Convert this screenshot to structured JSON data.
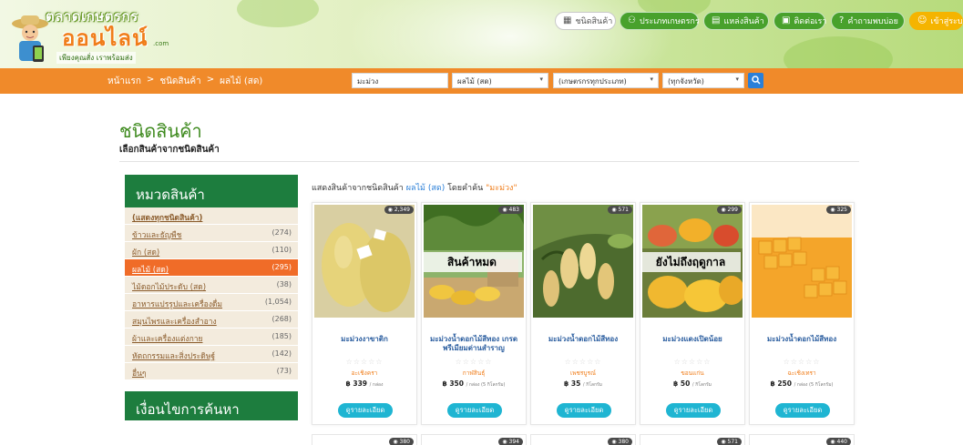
{
  "header": {
    "logo": {
      "top_text": "ตลาดเกษตรกร",
      "main_text": "ออนไลน์",
      "domain_text": ".com",
      "tagline": "เพียงคุณสั่ง เราพร้อมส่ง"
    },
    "nav": [
      {
        "label": "ชนิดสินค้า",
        "icon": "cart-icon"
      },
      {
        "label": "ประเภทเกษตรกร",
        "icon": "people-icon"
      },
      {
        "label": "แหล่งสินค้า",
        "icon": "map-icon"
      },
      {
        "label": "ติดต่อเรา",
        "icon": "contact-icon"
      },
      {
        "label": "คำถามพบบ่อย",
        "icon": "question-icon"
      },
      {
        "label": "เข้าสู่ระบบ",
        "icon": "user-icon"
      }
    ]
  },
  "breadcrumb": {
    "home": "หน้าแรก",
    "level1": "ชนิดสินค้า",
    "level2": "ผลไม้ (สด)",
    "separator": ">"
  },
  "search": {
    "keyword": "มะม่วง",
    "category": "ผลไม้ (สด)",
    "farmer_type": "(เกษตรกรทุกประเภท)",
    "province": "(ทุกจังหวัด)",
    "button_icon": "search-icon"
  },
  "page": {
    "title": "ชนิดสินค้า",
    "subtitle": "เลือกสินค้าจากชนิดสินค้า"
  },
  "sidebar": {
    "heading": "หมวดสินค้า",
    "items": [
      {
        "label": "(แสดงทุกชนิดสินค้า)",
        "count": ""
      },
      {
        "label": "ข้าวและธัญพืช",
        "count": "(274)"
      },
      {
        "label": "ผัก (สด)",
        "count": "(110)"
      },
      {
        "label": "ผลไม้ (สด)",
        "count": "(295)"
      },
      {
        "label": "ไม้ดอกไม้ประดับ (สด)",
        "count": "(38)"
      },
      {
        "label": "อาหารแปรรูปและเครื่องดื่ม",
        "count": "(1,054)"
      },
      {
        "label": "สมุนไพรและเครื่องสำอาง",
        "count": "(268)"
      },
      {
        "label": "ผ้าและเครื่องแต่งกาย",
        "count": "(185)"
      },
      {
        "label": "หัตถกรรมและสิ่งประดิษฐ์",
        "count": "(142)"
      },
      {
        "label": "อื่นๆ",
        "count": "(73)"
      }
    ],
    "heading2": "เงื่อนไขการค้นหา"
  },
  "results": {
    "prefix": "แสดงสินค้าจากชนิดสินค้า",
    "category": "ผลไม้ (สด)",
    "middle": "โดยคำค้น",
    "query": "\"มะม่วง\""
  },
  "products": [
    {
      "views": "2,349",
      "overlay": "",
      "name": "มะม่วงงาขาติก",
      "stars": "☆☆☆☆☆",
      "shop": "อะเชิงครา",
      "price": "฿ 339",
      "unit": "/ กล่อง",
      "button": "ดูรายละเอียด"
    },
    {
      "views": "483",
      "overlay": "สินค้าหมด",
      "name": "มะม่วงน้ำดอกไม้สีทอง เกรดพรีเมียมด่านสำราญ",
      "stars": "☆☆☆☆☆",
      "shop": "กาฬสินธุ์",
      "price": "฿ 350",
      "unit": "/ กล่อง (5 กิโลกรัม)",
      "button": "ดูรายละเอียด"
    },
    {
      "views": "571",
      "overlay": "",
      "name": "มะม่วงน้ำดอกไม้สีทอง",
      "stars": "☆☆☆☆☆",
      "shop": "เพชรบูรณ์",
      "price": "฿ 35",
      "unit": "/ กิโลกรัม",
      "button": "ดูรายละเอียด"
    },
    {
      "views": "299",
      "overlay": "ยังไม่ถึงฤดูกาล",
      "name": "มะม่วงแดงเปิดน้อย",
      "stars": "☆☆☆☆☆",
      "shop": "ขอนแก่น",
      "price": "฿ 50",
      "unit": "/ กิโลกรัม",
      "button": "ดูรายละเอียด"
    },
    {
      "views": "325",
      "overlay": "",
      "name": "มะม่วงน้ำดอกไม้สีทอง",
      "stars": "☆☆☆☆☆",
      "shop": "ฉะเชิงเทรา",
      "price": "฿ 250",
      "unit": "/ กล่อง (5 กิโลกรัม)",
      "button": "ดูรายละเอียด"
    }
  ],
  "next_row_views": [
    "380",
    "394",
    "380",
    "571",
    "440"
  ]
}
